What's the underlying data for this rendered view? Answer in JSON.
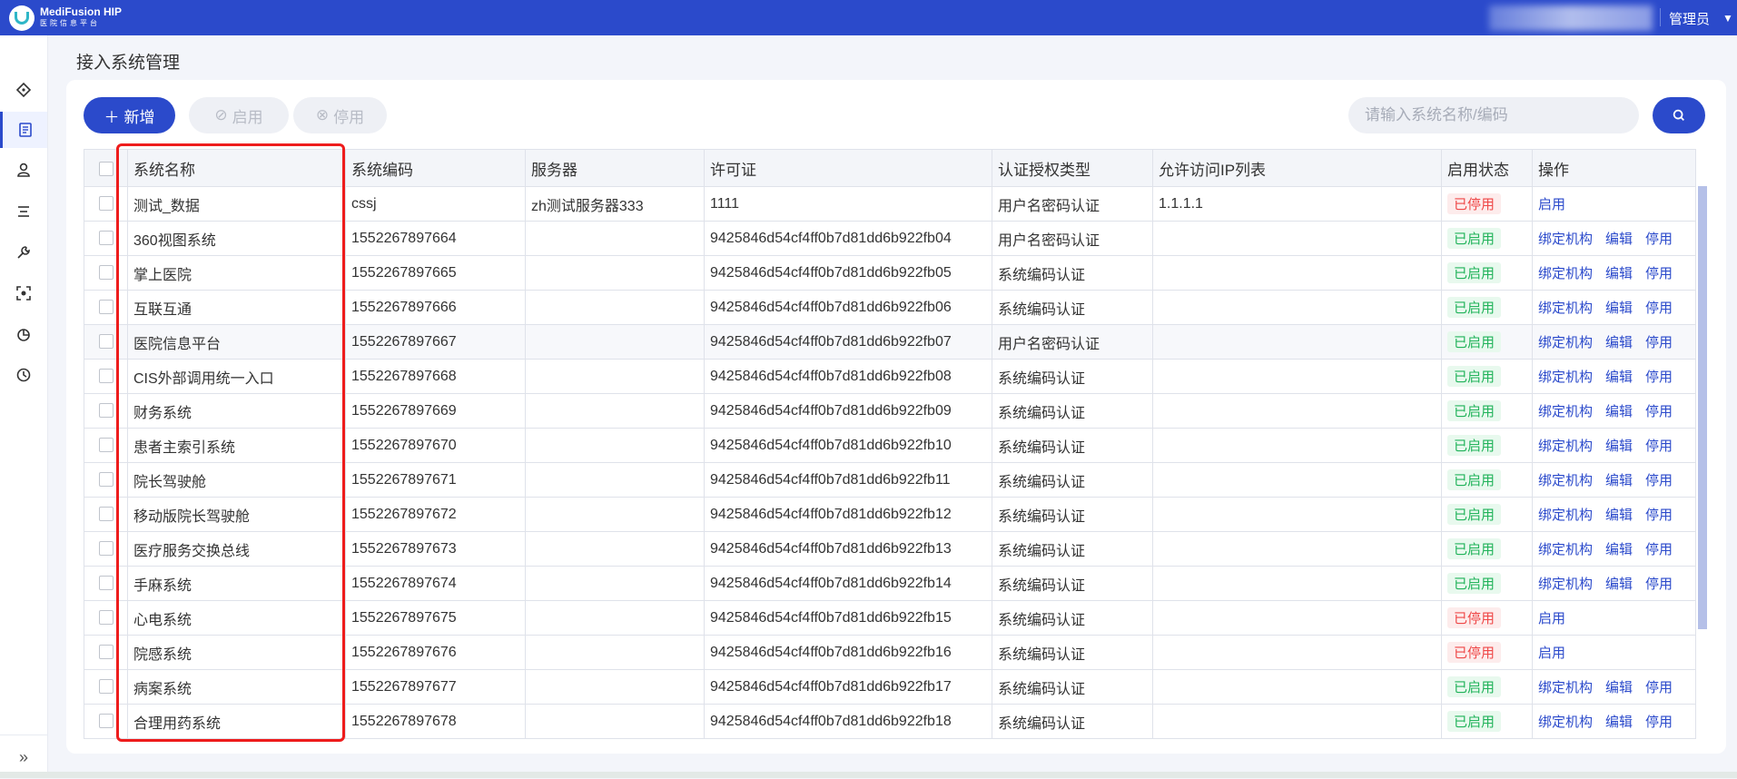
{
  "header": {
    "brand_name": "MediFusion HIP",
    "brand_sub": "医院信息平台",
    "user": "管理员"
  },
  "sidebar": {
    "icons": [
      "home-icon",
      "document-icon",
      "user-icon",
      "list-icon",
      "wrench-icon",
      "scan-icon",
      "pie-chart-icon",
      "clock-icon"
    ],
    "active_index": 1,
    "expand_label": "»"
  },
  "page": {
    "title": "接入系统管理"
  },
  "toolbar": {
    "add_label": "新增",
    "enable_label": "启用",
    "disable_label": "停用",
    "search_placeholder": "请输入系统名称/编码"
  },
  "table": {
    "columns": [
      "系统名称",
      "系统编码",
      "服务器",
      "许可证",
      "认证授权类型",
      "允许访问IP列表",
      "启用状态",
      "操作"
    ],
    "rows": [
      {
        "name": "测试_数据",
        "code": "cssj",
        "server": "zh测试服务器333",
        "license": "1111",
        "auth": "用户名密码认证",
        "ip": "1.1.1.1",
        "status": "已停用",
        "ops": [
          "启用"
        ]
      },
      {
        "name": "360视图系统",
        "code": "1552267897664",
        "server": "",
        "license": "9425846d54cf4ff0b7d81dd6b922fb04",
        "auth": "用户名密码认证",
        "ip": "",
        "status": "已启用",
        "ops": [
          "绑定机构",
          "编辑",
          "停用"
        ]
      },
      {
        "name": "掌上医院",
        "code": "1552267897665",
        "server": "",
        "license": "9425846d54cf4ff0b7d81dd6b922fb05",
        "auth": "系统编码认证",
        "ip": "",
        "status": "已启用",
        "ops": [
          "绑定机构",
          "编辑",
          "停用"
        ]
      },
      {
        "name": "互联互通",
        "code": "1552267897666",
        "server": "",
        "license": "9425846d54cf4ff0b7d81dd6b922fb06",
        "auth": "系统编码认证",
        "ip": "",
        "status": "已启用",
        "ops": [
          "绑定机构",
          "编辑",
          "停用"
        ]
      },
      {
        "name": "医院信息平台",
        "code": "1552267897667",
        "server": "",
        "license": "9425846d54cf4ff0b7d81dd6b922fb07",
        "auth": "用户名密码认证",
        "ip": "",
        "status": "已启用",
        "ops": [
          "绑定机构",
          "编辑",
          "停用"
        ]
      },
      {
        "name": "CIS外部调用统一入口",
        "code": "1552267897668",
        "server": "",
        "license": "9425846d54cf4ff0b7d81dd6b922fb08",
        "auth": "系统编码认证",
        "ip": "",
        "status": "已启用",
        "ops": [
          "绑定机构",
          "编辑",
          "停用"
        ]
      },
      {
        "name": "财务系统",
        "code": "1552267897669",
        "server": "",
        "license": "9425846d54cf4ff0b7d81dd6b922fb09",
        "auth": "系统编码认证",
        "ip": "",
        "status": "已启用",
        "ops": [
          "绑定机构",
          "编辑",
          "停用"
        ]
      },
      {
        "name": "患者主索引系统",
        "code": "1552267897670",
        "server": "",
        "license": "9425846d54cf4ff0b7d81dd6b922fb10",
        "auth": "系统编码认证",
        "ip": "",
        "status": "已启用",
        "ops": [
          "绑定机构",
          "编辑",
          "停用"
        ]
      },
      {
        "name": "院长驾驶舱",
        "code": "1552267897671",
        "server": "",
        "license": "9425846d54cf4ff0b7d81dd6b922fb11",
        "auth": "系统编码认证",
        "ip": "",
        "status": "已启用",
        "ops": [
          "绑定机构",
          "编辑",
          "停用"
        ]
      },
      {
        "name": "移动版院长驾驶舱",
        "code": "1552267897672",
        "server": "",
        "license": "9425846d54cf4ff0b7d81dd6b922fb12",
        "auth": "系统编码认证",
        "ip": "",
        "status": "已启用",
        "ops": [
          "绑定机构",
          "编辑",
          "停用"
        ]
      },
      {
        "name": "医疗服务交换总线",
        "code": "1552267897673",
        "server": "",
        "license": "9425846d54cf4ff0b7d81dd6b922fb13",
        "auth": "系统编码认证",
        "ip": "",
        "status": "已启用",
        "ops": [
          "绑定机构",
          "编辑",
          "停用"
        ]
      },
      {
        "name": "手麻系统",
        "code": "1552267897674",
        "server": "",
        "license": "9425846d54cf4ff0b7d81dd6b922fb14",
        "auth": "系统编码认证",
        "ip": "",
        "status": "已启用",
        "ops": [
          "绑定机构",
          "编辑",
          "停用"
        ]
      },
      {
        "name": "心电系统",
        "code": "1552267897675",
        "server": "",
        "license": "9425846d54cf4ff0b7d81dd6b922fb15",
        "auth": "系统编码认证",
        "ip": "",
        "status": "已停用",
        "ops": [
          "启用"
        ]
      },
      {
        "name": "院感系统",
        "code": "1552267897676",
        "server": "",
        "license": "9425846d54cf4ff0b7d81dd6b922fb16",
        "auth": "系统编码认证",
        "ip": "",
        "status": "已停用",
        "ops": [
          "启用"
        ]
      },
      {
        "name": "病案系统",
        "code": "1552267897677",
        "server": "",
        "license": "9425846d54cf4ff0b7d81dd6b922fb17",
        "auth": "系统编码认证",
        "ip": "",
        "status": "已启用",
        "ops": [
          "绑定机构",
          "编辑",
          "停用"
        ]
      },
      {
        "name": "合理用药系统",
        "code": "1552267897678",
        "server": "",
        "license": "9425846d54cf4ff0b7d81dd6b922fb18",
        "auth": "系统编码认证",
        "ip": "",
        "status": "已启用",
        "ops": [
          "绑定机构",
          "编辑",
          "停用"
        ]
      }
    ]
  },
  "colors": {
    "primary": "#2b4acb",
    "enabled": "#21b35a",
    "disabled": "#ef4848",
    "highlight": "#ee1c1c"
  }
}
